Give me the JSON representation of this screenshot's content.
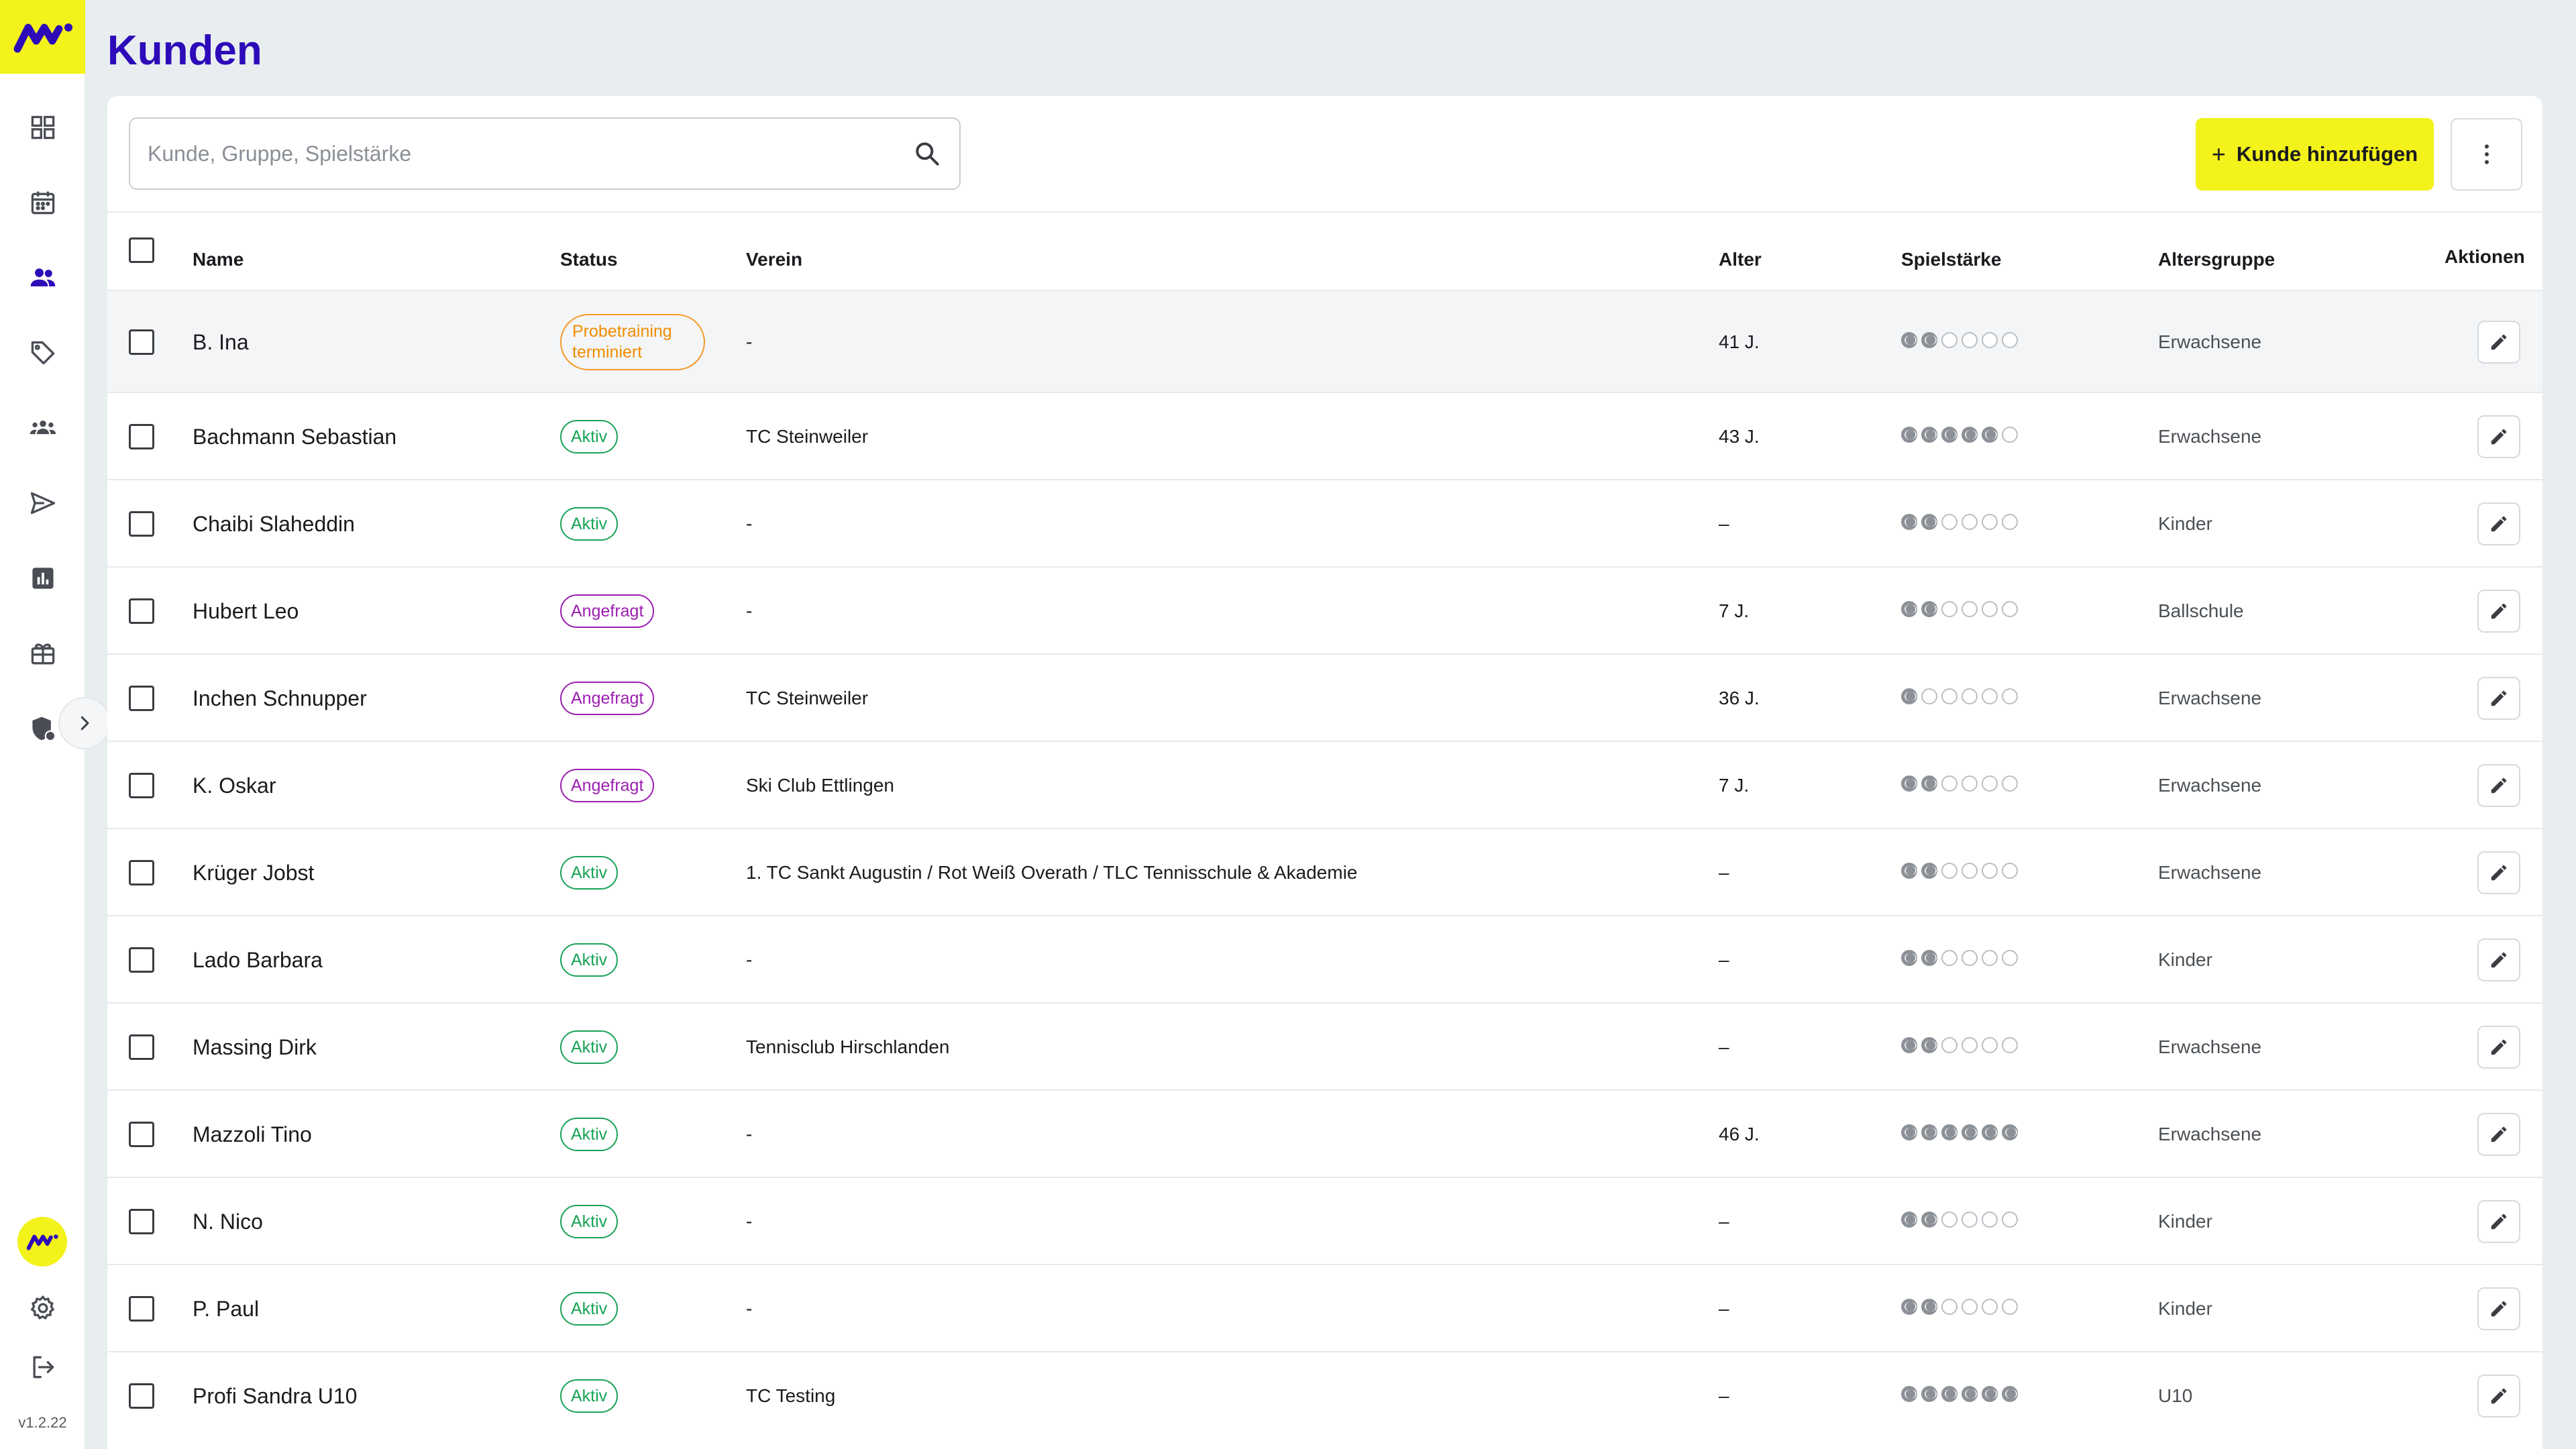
{
  "app": {
    "version": "v1.2.22"
  },
  "header": {
    "title": "Kunden"
  },
  "toolbar": {
    "search_placeholder": "Kunde, Gruppe, Spielstärke",
    "search_value": "",
    "add_label": "Kunde hinzufügen",
    "add_icon": "+"
  },
  "table": {
    "columns": {
      "name": "Name",
      "status": "Status",
      "club": "Verein",
      "age": "Alter",
      "level": "Spielstärke",
      "agegroup": "Altersgruppe",
      "actions": "Aktionen"
    },
    "level_max": 6,
    "rows": [
      {
        "name": "B. Ina",
        "status": "Probetraining terminiert",
        "status_type": "probe",
        "club": "-",
        "age": "41 J.",
        "level": 2,
        "agegroup": "Erwachsene"
      },
      {
        "name": "Bachmann Sebastian",
        "status": "Aktiv",
        "status_type": "aktiv",
        "club": "TC Steinweiler",
        "age": "43 J.",
        "level": 5,
        "agegroup": "Erwachsene"
      },
      {
        "name": "Chaibi Slaheddin",
        "status": "Aktiv",
        "status_type": "aktiv",
        "club": "-",
        "age": "–",
        "level": 2,
        "agegroup": "Kinder"
      },
      {
        "name": "Hubert Leo",
        "status": "Angefragt",
        "status_type": "angefragt",
        "club": "-",
        "age": "7 J.",
        "level": 2,
        "agegroup": "Ballschule"
      },
      {
        "name": "Inchen Schnupper",
        "status": "Angefragt",
        "status_type": "angefragt",
        "club": "TC Steinweiler",
        "age": "36 J.",
        "level": 1,
        "agegroup": "Erwachsene"
      },
      {
        "name": "K. Oskar",
        "status": "Angefragt",
        "status_type": "angefragt",
        "club": "Ski Club Ettlingen",
        "age": "7 J.",
        "level": 2,
        "agegroup": "Erwachsene"
      },
      {
        "name": "Krüger Jobst",
        "status": "Aktiv",
        "status_type": "aktiv",
        "club": "1. TC Sankt Augustin / Rot Weiß Overath / TLC Tennisschule & Akademie",
        "age": "–",
        "level": 2,
        "agegroup": "Erwachsene"
      },
      {
        "name": "Lado Barbara",
        "status": "Aktiv",
        "status_type": "aktiv",
        "club": "-",
        "age": "–",
        "level": 2,
        "agegroup": "Kinder"
      },
      {
        "name": "Massing Dirk",
        "status": "Aktiv",
        "status_type": "aktiv",
        "club": "Tennisclub Hirschlanden",
        "age": "–",
        "level": 2,
        "agegroup": "Erwachsene"
      },
      {
        "name": "Mazzoli Tino",
        "status": "Aktiv",
        "status_type": "aktiv",
        "club": "-",
        "age": "46 J.",
        "level": 6,
        "agegroup": "Erwachsene"
      },
      {
        "name": "N. Nico",
        "status": "Aktiv",
        "status_type": "aktiv",
        "club": "-",
        "age": "–",
        "level": 2,
        "agegroup": "Kinder"
      },
      {
        "name": "P. Paul",
        "status": "Aktiv",
        "status_type": "aktiv",
        "club": "-",
        "age": "–",
        "level": 2,
        "agegroup": "Kinder"
      },
      {
        "name": "Profi Sandra U10",
        "status": "Aktiv",
        "status_type": "aktiv",
        "club": "TC Testing",
        "age": "–",
        "level": 6,
        "agegroup": "U10"
      }
    ]
  },
  "sidebar": {
    "items": [
      {
        "icon": "dashboard-icon"
      },
      {
        "icon": "calendar-icon"
      },
      {
        "icon": "customers-icon",
        "active": true
      },
      {
        "icon": "tag-icon"
      },
      {
        "icon": "groups-icon"
      },
      {
        "icon": "send-icon"
      },
      {
        "icon": "chart-icon"
      },
      {
        "icon": "gift-icon"
      },
      {
        "icon": "shield-icon"
      }
    ],
    "bottom": [
      {
        "icon": "brand-logo-icon"
      },
      {
        "icon": "gear-icon"
      },
      {
        "icon": "logout-icon"
      }
    ]
  },
  "colors": {
    "accent": "#f3f21b",
    "primary": "#2d0bb8",
    "active_status": "#18a356",
    "requested_status": "#9b1fb0",
    "trial_status": "#f08c00"
  }
}
